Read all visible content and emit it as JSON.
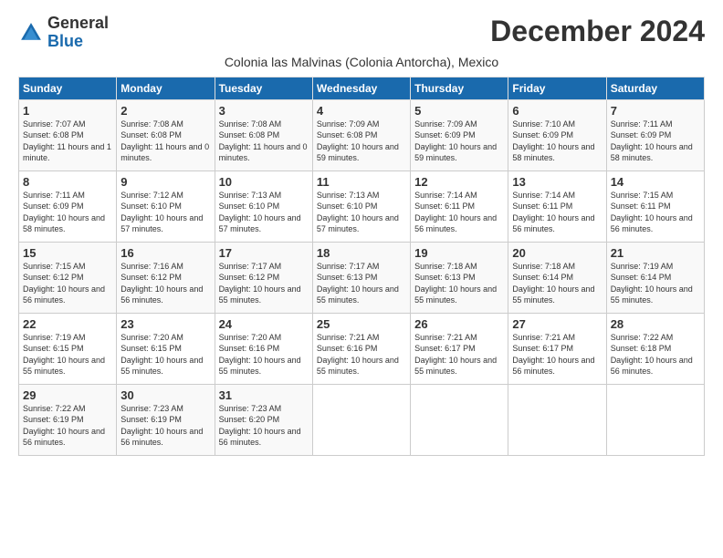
{
  "logo": {
    "general": "General",
    "blue": "Blue"
  },
  "title": "December 2024",
  "subtitle": "Colonia las Malvinas (Colonia Antorcha), Mexico",
  "days_of_week": [
    "Sunday",
    "Monday",
    "Tuesday",
    "Wednesday",
    "Thursday",
    "Friday",
    "Saturday"
  ],
  "weeks": [
    [
      {
        "day": "1",
        "sunrise": "7:07 AM",
        "sunset": "6:08 PM",
        "daylight": "11 hours and 1 minute."
      },
      {
        "day": "2",
        "sunrise": "7:08 AM",
        "sunset": "6:08 PM",
        "daylight": "11 hours and 0 minutes."
      },
      {
        "day": "3",
        "sunrise": "7:08 AM",
        "sunset": "6:08 PM",
        "daylight": "11 hours and 0 minutes."
      },
      {
        "day": "4",
        "sunrise": "7:09 AM",
        "sunset": "6:08 PM",
        "daylight": "10 hours and 59 minutes."
      },
      {
        "day": "5",
        "sunrise": "7:09 AM",
        "sunset": "6:09 PM",
        "daylight": "10 hours and 59 minutes."
      },
      {
        "day": "6",
        "sunrise": "7:10 AM",
        "sunset": "6:09 PM",
        "daylight": "10 hours and 58 minutes."
      },
      {
        "day": "7",
        "sunrise": "7:11 AM",
        "sunset": "6:09 PM",
        "daylight": "10 hours and 58 minutes."
      }
    ],
    [
      {
        "day": "8",
        "sunrise": "7:11 AM",
        "sunset": "6:09 PM",
        "daylight": "10 hours and 58 minutes."
      },
      {
        "day": "9",
        "sunrise": "7:12 AM",
        "sunset": "6:10 PM",
        "daylight": "10 hours and 57 minutes."
      },
      {
        "day": "10",
        "sunrise": "7:13 AM",
        "sunset": "6:10 PM",
        "daylight": "10 hours and 57 minutes."
      },
      {
        "day": "11",
        "sunrise": "7:13 AM",
        "sunset": "6:10 PM",
        "daylight": "10 hours and 57 minutes."
      },
      {
        "day": "12",
        "sunrise": "7:14 AM",
        "sunset": "6:11 PM",
        "daylight": "10 hours and 56 minutes."
      },
      {
        "day": "13",
        "sunrise": "7:14 AM",
        "sunset": "6:11 PM",
        "daylight": "10 hours and 56 minutes."
      },
      {
        "day": "14",
        "sunrise": "7:15 AM",
        "sunset": "6:11 PM",
        "daylight": "10 hours and 56 minutes."
      }
    ],
    [
      {
        "day": "15",
        "sunrise": "7:15 AM",
        "sunset": "6:12 PM",
        "daylight": "10 hours and 56 minutes."
      },
      {
        "day": "16",
        "sunrise": "7:16 AM",
        "sunset": "6:12 PM",
        "daylight": "10 hours and 56 minutes."
      },
      {
        "day": "17",
        "sunrise": "7:17 AM",
        "sunset": "6:12 PM",
        "daylight": "10 hours and 55 minutes."
      },
      {
        "day": "18",
        "sunrise": "7:17 AM",
        "sunset": "6:13 PM",
        "daylight": "10 hours and 55 minutes."
      },
      {
        "day": "19",
        "sunrise": "7:18 AM",
        "sunset": "6:13 PM",
        "daylight": "10 hours and 55 minutes."
      },
      {
        "day": "20",
        "sunrise": "7:18 AM",
        "sunset": "6:14 PM",
        "daylight": "10 hours and 55 minutes."
      },
      {
        "day": "21",
        "sunrise": "7:19 AM",
        "sunset": "6:14 PM",
        "daylight": "10 hours and 55 minutes."
      }
    ],
    [
      {
        "day": "22",
        "sunrise": "7:19 AM",
        "sunset": "6:15 PM",
        "daylight": "10 hours and 55 minutes."
      },
      {
        "day": "23",
        "sunrise": "7:20 AM",
        "sunset": "6:15 PM",
        "daylight": "10 hours and 55 minutes."
      },
      {
        "day": "24",
        "sunrise": "7:20 AM",
        "sunset": "6:16 PM",
        "daylight": "10 hours and 55 minutes."
      },
      {
        "day": "25",
        "sunrise": "7:21 AM",
        "sunset": "6:16 PM",
        "daylight": "10 hours and 55 minutes."
      },
      {
        "day": "26",
        "sunrise": "7:21 AM",
        "sunset": "6:17 PM",
        "daylight": "10 hours and 55 minutes."
      },
      {
        "day": "27",
        "sunrise": "7:21 AM",
        "sunset": "6:17 PM",
        "daylight": "10 hours and 56 minutes."
      },
      {
        "day": "28",
        "sunrise": "7:22 AM",
        "sunset": "6:18 PM",
        "daylight": "10 hours and 56 minutes."
      }
    ],
    [
      {
        "day": "29",
        "sunrise": "7:22 AM",
        "sunset": "6:19 PM",
        "daylight": "10 hours and 56 minutes."
      },
      {
        "day": "30",
        "sunrise": "7:23 AM",
        "sunset": "6:19 PM",
        "daylight": "10 hours and 56 minutes."
      },
      {
        "day": "31",
        "sunrise": "7:23 AM",
        "sunset": "6:20 PM",
        "daylight": "10 hours and 56 minutes."
      },
      null,
      null,
      null,
      null
    ]
  ]
}
